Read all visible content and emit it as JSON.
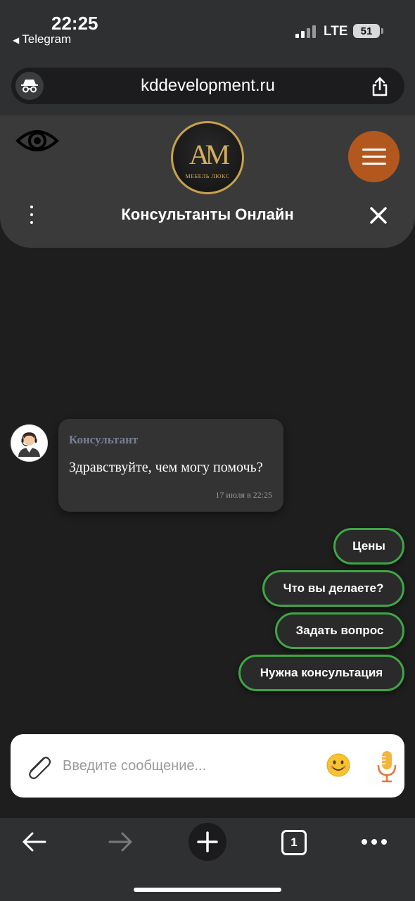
{
  "status_bar": {
    "time": "22:25",
    "back_app": "Telegram",
    "network": "LTE",
    "battery": "51"
  },
  "browser": {
    "url": "kddevelopment.ru",
    "tab_count": "1"
  },
  "site": {
    "logo_mark": "AM",
    "logo_subtitle": "МЕБЕЛЬ ЛЮКС",
    "menu_color": "#b2581f",
    "chat_title": "Консультанты Онлайн"
  },
  "chat": {
    "message": {
      "sender": "Консультант",
      "text": "Здравствуйте, чем могу помочь?",
      "time": "17 июля в 22:25"
    },
    "quick_replies": [
      {
        "label": "Цены"
      },
      {
        "label": "Что вы делаете?"
      },
      {
        "label": "Задать вопрос"
      },
      {
        "label": "Нужна консультация"
      }
    ],
    "accent": "#3ea744"
  },
  "composer": {
    "placeholder": "Введите сообщение..."
  },
  "icons": {
    "incognito": "incognito-icon",
    "share": "share-icon",
    "eye": "eye-icon",
    "menu": "hamburger-icon",
    "attach": "paperclip-icon",
    "emoji": "emoji-icon",
    "mic": "microphone-icon",
    "back": "arrow-left-icon",
    "forward": "arrow-right-icon",
    "new_tab": "plus-icon",
    "more": "more-dots-icon"
  }
}
